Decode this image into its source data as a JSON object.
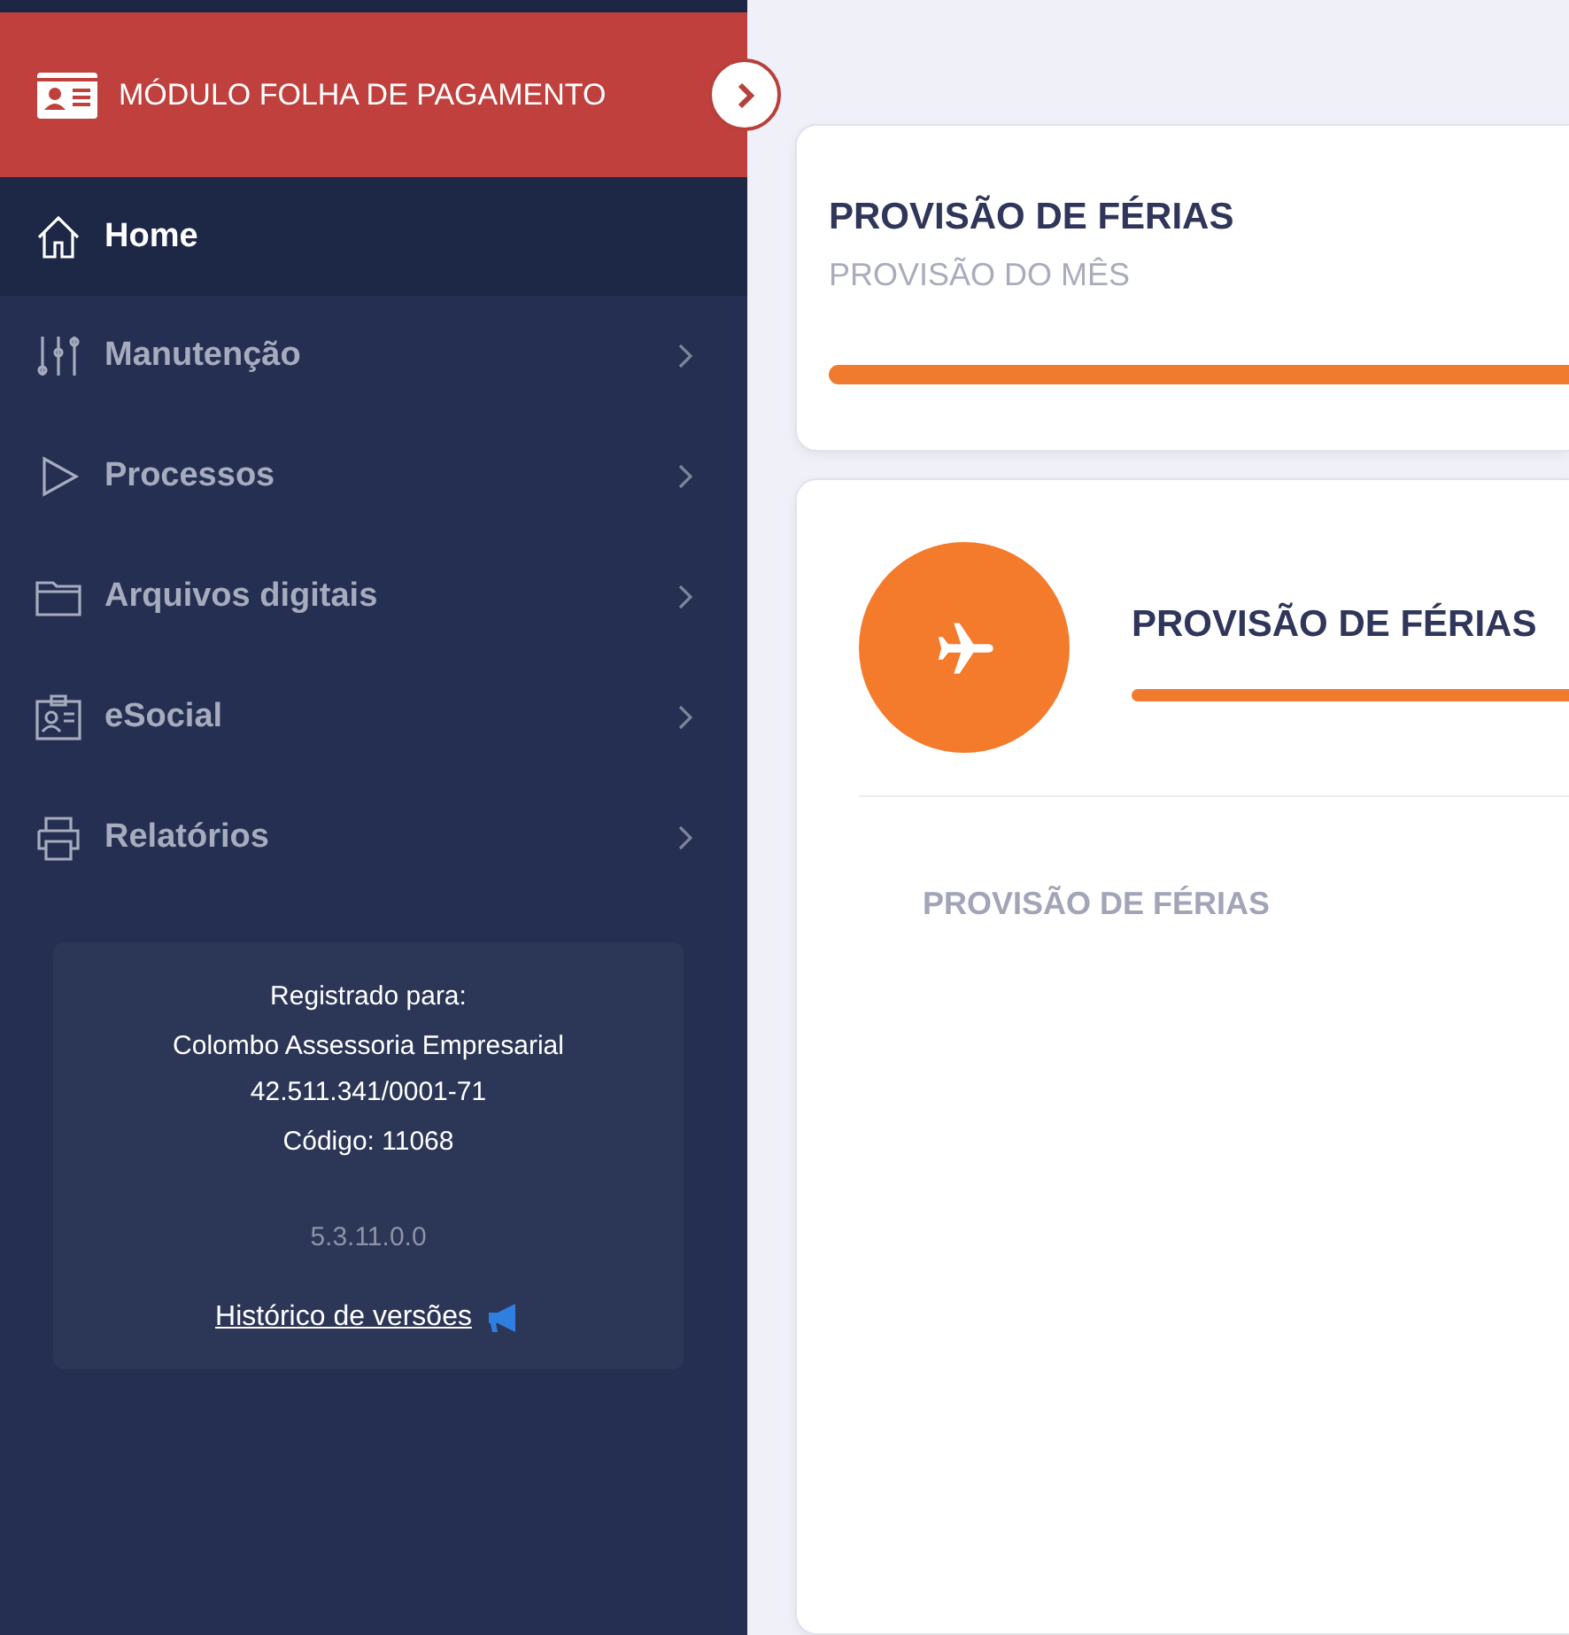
{
  "sidebar": {
    "module_title": "MÓDULO FOLHA DE PAGAMENTO",
    "items": [
      {
        "kind": "home",
        "label": "Home",
        "selected": true,
        "has_submenu": false
      },
      {
        "kind": "sliders",
        "label": "Manutenção",
        "selected": false,
        "has_submenu": true
      },
      {
        "kind": "play",
        "label": "Processos",
        "selected": false,
        "has_submenu": true
      },
      {
        "kind": "folder",
        "label": "Arquivos digitais",
        "selected": false,
        "has_submenu": true
      },
      {
        "kind": "badge",
        "label": "eSocial",
        "selected": false,
        "has_submenu": true
      },
      {
        "kind": "printer",
        "label": "Relatórios",
        "selected": false,
        "has_submenu": true
      }
    ],
    "registration": {
      "heading": "Registrado para:",
      "company": "Colombo Assessoria Empresarial",
      "cnpj": "42.511.341/0001-71",
      "code": "Código: 11068",
      "version": "5.3.11.0.0",
      "history_link": "Histórico de versões"
    }
  },
  "summary_card": {
    "title": "PROVISÃO DE FÉRIAS",
    "subtitle": "PROVISÃO DO MÊS"
  },
  "detail_card": {
    "title": "PROVISÃO DE FÉRIAS",
    "section_label": "PROVISÃO DE FÉRIAS"
  }
}
